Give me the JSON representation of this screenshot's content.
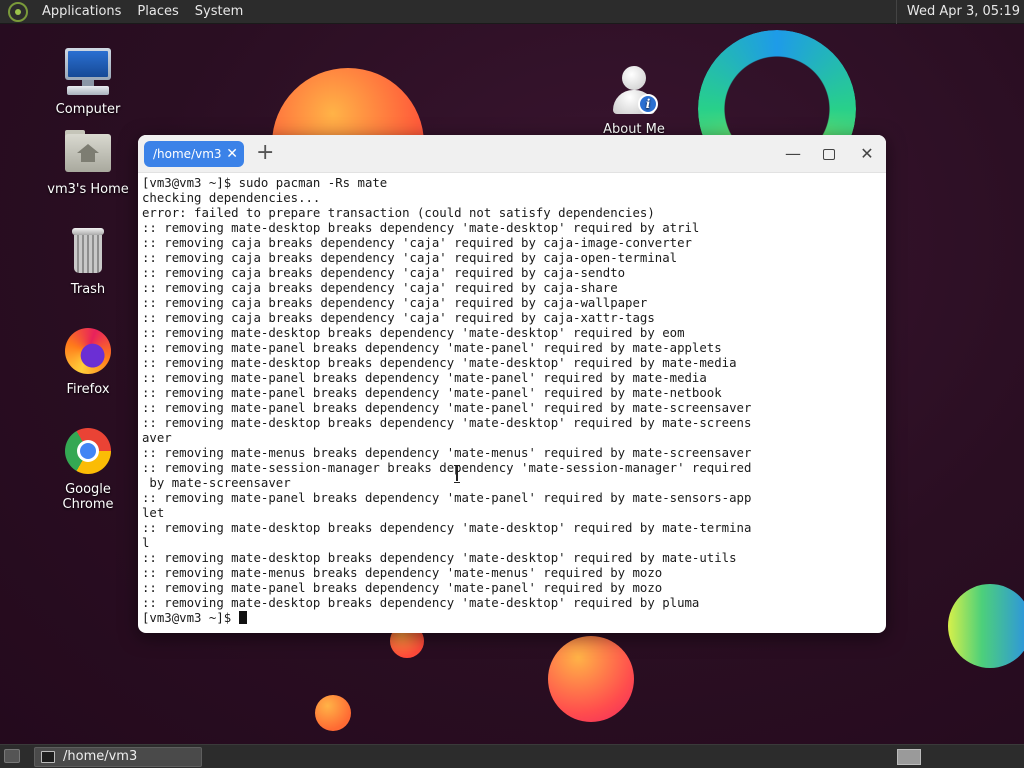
{
  "top_panel": {
    "menus": [
      "Applications",
      "Places",
      "System"
    ],
    "clock": "Wed Apr  3, 05:19"
  },
  "desktop": {
    "icons": [
      {
        "label": "Computer",
        "icon": "computer-icon"
      },
      {
        "label": "vm3's Home",
        "icon": "home-folder-icon"
      },
      {
        "label": "Trash",
        "icon": "trash-icon"
      },
      {
        "label": "Firefox",
        "icon": "firefox-icon"
      },
      {
        "label": "Google Chrome",
        "icon": "chrome-icon"
      },
      {
        "label": "About Me",
        "icon": "about-me-icon"
      }
    ]
  },
  "terminal": {
    "tab_title": "/home/vm3",
    "lines": [
      "[vm3@vm3 ~]$ sudo pacman -Rs mate",
      "checking dependencies...",
      "error: failed to prepare transaction (could not satisfy dependencies)",
      ":: removing mate-desktop breaks dependency 'mate-desktop' required by atril",
      ":: removing caja breaks dependency 'caja' required by caja-image-converter",
      ":: removing caja breaks dependency 'caja' required by caja-open-terminal",
      ":: removing caja breaks dependency 'caja' required by caja-sendto",
      ":: removing caja breaks dependency 'caja' required by caja-share",
      ":: removing caja breaks dependency 'caja' required by caja-wallpaper",
      ":: removing caja breaks dependency 'caja' required by caja-xattr-tags",
      ":: removing mate-desktop breaks dependency 'mate-desktop' required by eom",
      ":: removing mate-panel breaks dependency 'mate-panel' required by mate-applets",
      ":: removing mate-desktop breaks dependency 'mate-desktop' required by mate-media",
      ":: removing mate-panel breaks dependency 'mate-panel' required by mate-media",
      ":: removing mate-panel breaks dependency 'mate-panel' required by mate-netbook",
      ":: removing mate-panel breaks dependency 'mate-panel' required by mate-screensaver",
      ":: removing mate-desktop breaks dependency 'mate-desktop' required by mate-screens",
      "aver",
      ":: removing mate-menus breaks dependency 'mate-menus' required by mate-screensaver",
      ":: removing mate-session-manager breaks dependency 'mate-session-manager' required",
      " by mate-screensaver",
      ":: removing mate-panel breaks dependency 'mate-panel' required by mate-sensors-app",
      "let",
      ":: removing mate-desktop breaks dependency 'mate-desktop' required by mate-termina",
      "l",
      ":: removing mate-desktop breaks dependency 'mate-desktop' required by mate-utils",
      ":: removing mate-menus breaks dependency 'mate-menus' required by mozo",
      ":: removing mate-panel breaks dependency 'mate-panel' required by mozo",
      ":: removing mate-desktop breaks dependency 'mate-desktop' required by pluma"
    ],
    "prompt": "[vm3@vm3 ~]$ "
  },
  "taskbar": {
    "task_label": "/home/vm3"
  },
  "colors": {
    "accent_tab": "#3b82e8",
    "panel_bg": "#2c2c2c"
  }
}
